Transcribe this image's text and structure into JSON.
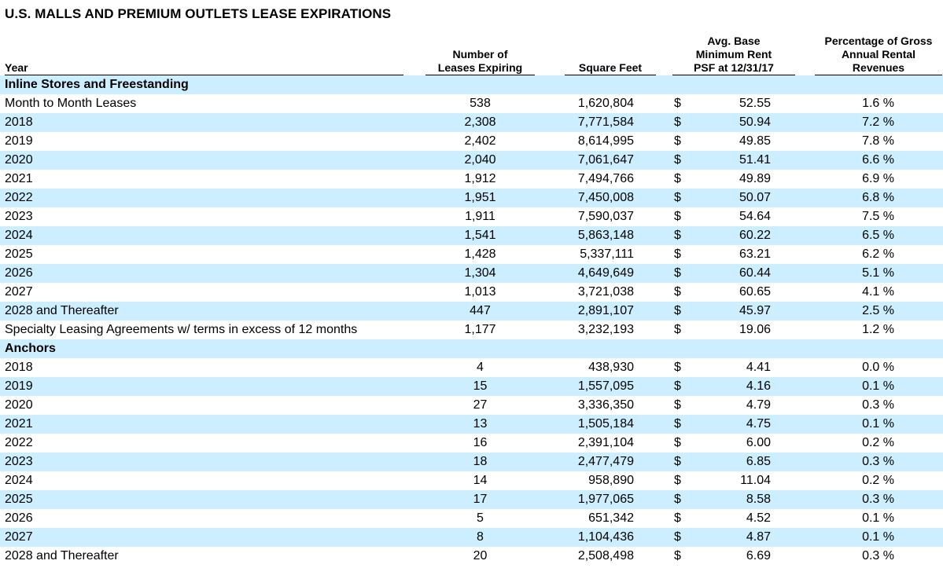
{
  "title": "U.S. MALLS AND PREMIUM OUTLETS LEASE EXPIRATIONS",
  "headers": {
    "year": "Year",
    "leases": "Number of\nLeases Expiring",
    "sqft": "Square Feet",
    "rent": "Avg. Base\nMinimum Rent\nPSF at 12/31/17",
    "pct": "Percentage of Gross\nAnnual Rental\nRevenues"
  },
  "rows": [
    {
      "type": "section",
      "label": "Inline Stores and Freestanding"
    },
    {
      "year": "Month to Month Leases",
      "leases": "538",
      "sqft": "1,620,804",
      "dollar": "$",
      "rent": "52.55",
      "pct": "1.6 %"
    },
    {
      "year": "2018",
      "leases": "2,308",
      "sqft": "7,771,584",
      "dollar": "$",
      "rent": "50.94",
      "pct": "7.2 %"
    },
    {
      "year": "2019",
      "leases": "2,402",
      "sqft": "8,614,995",
      "dollar": "$",
      "rent": "49.85",
      "pct": "7.8 %"
    },
    {
      "year": "2020",
      "leases": "2,040",
      "sqft": "7,061,647",
      "dollar": "$",
      "rent": "51.41",
      "pct": "6.6 %"
    },
    {
      "year": "2021",
      "leases": "1,912",
      "sqft": "7,494,766",
      "dollar": "$",
      "rent": "49.89",
      "pct": "6.9 %"
    },
    {
      "year": "2022",
      "leases": "1,951",
      "sqft": "7,450,008",
      "dollar": "$",
      "rent": "50.07",
      "pct": "6.8 %"
    },
    {
      "year": "2023",
      "leases": "1,911",
      "sqft": "7,590,037",
      "dollar": "$",
      "rent": "54.64",
      "pct": "7.5 %"
    },
    {
      "year": "2024",
      "leases": "1,541",
      "sqft": "5,863,148",
      "dollar": "$",
      "rent": "60.22",
      "pct": "6.5 %"
    },
    {
      "year": "2025",
      "leases": "1,428",
      "sqft": "5,337,111",
      "dollar": "$",
      "rent": "63.21",
      "pct": "6.2 %"
    },
    {
      "year": "2026",
      "leases": "1,304",
      "sqft": "4,649,649",
      "dollar": "$",
      "rent": "60.44",
      "pct": "5.1 %"
    },
    {
      "year": "2027",
      "leases": "1,013",
      "sqft": "3,721,038",
      "dollar": "$",
      "rent": "60.65",
      "pct": "4.1 %"
    },
    {
      "year": "2028 and Thereafter",
      "leases": "447",
      "sqft": "2,891,107",
      "dollar": "$",
      "rent": "45.97",
      "pct": "2.5 %"
    },
    {
      "year": "Specialty Leasing Agreements w/ terms in excess of 12 months",
      "leases": "1,177",
      "sqft": "3,232,193",
      "dollar": "$",
      "rent": "19.06",
      "pct": "1.2 %"
    },
    {
      "type": "section",
      "label": "Anchors"
    },
    {
      "year": "2018",
      "leases": "4",
      "sqft": "438,930",
      "dollar": "$",
      "rent": "4.41",
      "pct": "0.0 %"
    },
    {
      "year": "2019",
      "leases": "15",
      "sqft": "1,557,095",
      "dollar": "$",
      "rent": "4.16",
      "pct": "0.1 %"
    },
    {
      "year": "2020",
      "leases": "27",
      "sqft": "3,336,350",
      "dollar": "$",
      "rent": "4.79",
      "pct": "0.3 %"
    },
    {
      "year": "2021",
      "leases": "13",
      "sqft": "1,505,184",
      "dollar": "$",
      "rent": "4.75",
      "pct": "0.1 %"
    },
    {
      "year": "2022",
      "leases": "16",
      "sqft": "2,391,104",
      "dollar": "$",
      "rent": "6.00",
      "pct": "0.2 %"
    },
    {
      "year": "2023",
      "leases": "18",
      "sqft": "2,477,479",
      "dollar": "$",
      "rent": "6.85",
      "pct": "0.3 %"
    },
    {
      "year": "2024",
      "leases": "14",
      "sqft": "958,890",
      "dollar": "$",
      "rent": "11.04",
      "pct": "0.2 %"
    },
    {
      "year": "2025",
      "leases": "17",
      "sqft": "1,977,065",
      "dollar": "$",
      "rent": "8.58",
      "pct": "0.3 %"
    },
    {
      "year": "2026",
      "leases": "5",
      "sqft": "651,342",
      "dollar": "$",
      "rent": "4.52",
      "pct": "0.1 %"
    },
    {
      "year": "2027",
      "leases": "8",
      "sqft": "1,104,436",
      "dollar": "$",
      "rent": "4.87",
      "pct": "0.1 %"
    },
    {
      "year": "2028 and Thereafter",
      "leases": "20",
      "sqft": "2,508,498",
      "dollar": "$",
      "rent": "6.69",
      "pct": "0.3 %"
    }
  ],
  "colors": {
    "row_shade": "#cceeff",
    "text": "#000000",
    "rule": "#000000"
  }
}
